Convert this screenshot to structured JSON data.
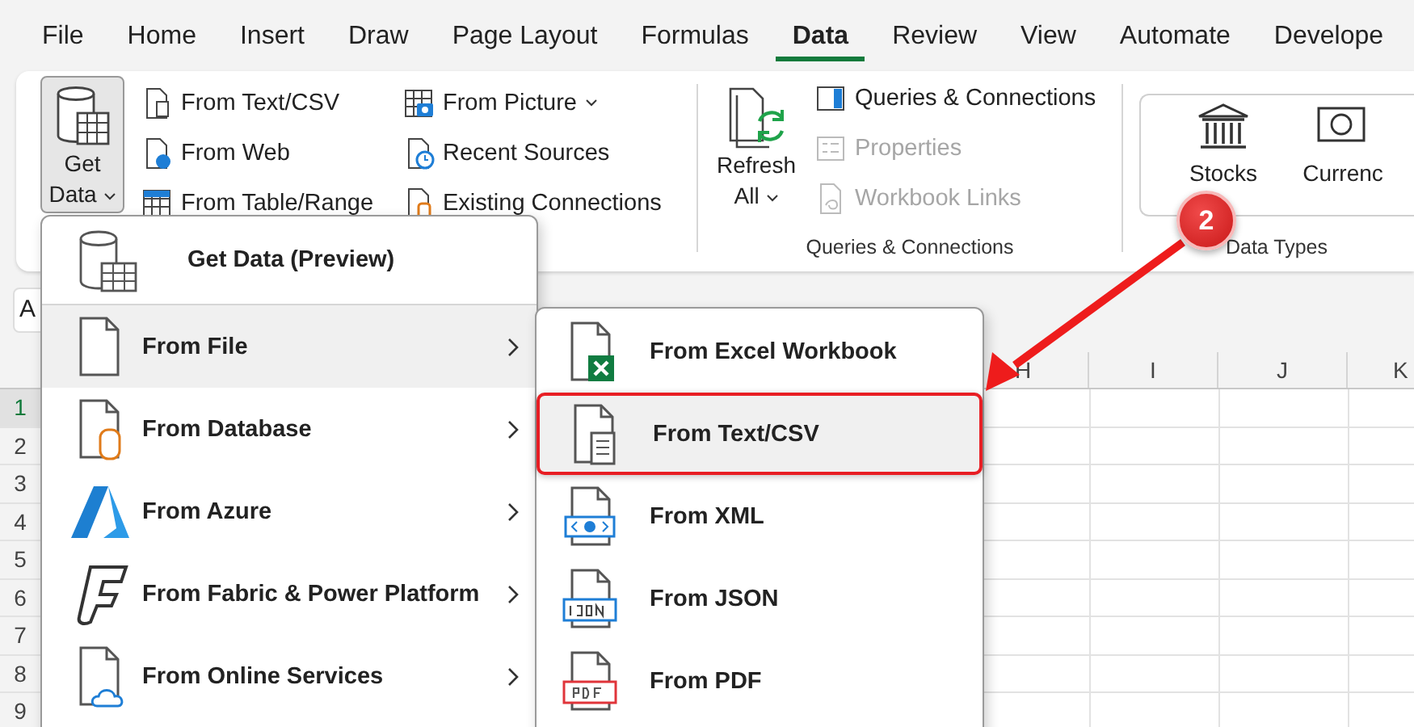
{
  "menu_tabs": [
    {
      "label": "File",
      "selected": false
    },
    {
      "label": "Home",
      "selected": false
    },
    {
      "label": "Insert",
      "selected": false
    },
    {
      "label": "Draw",
      "selected": false
    },
    {
      "label": "Page Layout",
      "selected": false
    },
    {
      "label": "Formulas",
      "selected": false
    },
    {
      "label": "Data",
      "selected": true
    },
    {
      "label": "Review",
      "selected": false
    },
    {
      "label": "View",
      "selected": false
    },
    {
      "label": "Automate",
      "selected": false
    },
    {
      "label": "Develope",
      "selected": false
    }
  ],
  "get_transform": {
    "get_data": {
      "lines": [
        "Get",
        "Data"
      ],
      "expanded": true
    },
    "columns": [
      [
        {
          "label": "From Text/CSV",
          "kind": "text",
          "dropdown": false
        },
        {
          "label": "From Web",
          "kind": "web",
          "dropdown": false
        },
        {
          "label": "From Table/Range",
          "kind": "table",
          "dropdown": false
        }
      ],
      [
        {
          "label": "From Picture",
          "kind": "picture",
          "dropdown": true
        },
        {
          "label": "Recent Sources",
          "kind": "recent",
          "dropdown": false
        },
        {
          "label": "Existing Connections",
          "kind": "existing",
          "dropdown": false
        }
      ]
    ]
  },
  "queries": {
    "refresh": {
      "lines": [
        "Refresh",
        "All"
      ]
    },
    "items": [
      {
        "label": "Queries & Connections",
        "kind": "queries",
        "disabled": false
      },
      {
        "label": "Properties",
        "kind": "properties",
        "disabled": true
      },
      {
        "label": "Workbook Links",
        "kind": "links",
        "disabled": true
      }
    ],
    "label": "Queries & Connections"
  },
  "data_types": {
    "items": [
      {
        "label": "Stocks",
        "kind": "stocks"
      },
      {
        "label": "Currenc",
        "kind": "currency"
      }
    ],
    "label": "Data Types"
  },
  "name_box": {
    "value": "A"
  },
  "sheet": {
    "columns": [
      "H",
      "I",
      "J",
      "K"
    ],
    "rows": [
      {
        "label": "1",
        "selected": true
      },
      {
        "label": "2",
        "selected": false
      },
      {
        "label": "3",
        "selected": false
      },
      {
        "label": "4",
        "selected": false
      },
      {
        "label": "5",
        "selected": false
      },
      {
        "label": "6",
        "selected": false
      },
      {
        "label": "7",
        "selected": false
      },
      {
        "label": "8",
        "selected": false
      },
      {
        "label": "9",
        "selected": false
      }
    ]
  },
  "get_data_menu": {
    "header": "Get Data (Preview)",
    "items": [
      {
        "label": "From File",
        "kind": "file",
        "selected": true
      },
      {
        "label": "From Database",
        "kind": "database",
        "selected": false
      },
      {
        "label": "From Azure",
        "kind": "azure",
        "selected": false
      },
      {
        "label": "From Fabric & Power Platform",
        "kind": "fabric",
        "selected": false
      },
      {
        "label": "From Online Services",
        "kind": "online",
        "selected": false
      }
    ]
  },
  "file_submenu": {
    "items": [
      {
        "label": "From Excel Workbook",
        "kind": "excel",
        "selected": false,
        "highlighted": false
      },
      {
        "label": "From Text/CSV",
        "kind": "text",
        "selected": true,
        "highlighted": true
      },
      {
        "label": "From XML",
        "kind": "xml",
        "selected": false,
        "highlighted": false
      },
      {
        "label": "From JSON",
        "kind": "json",
        "selected": false,
        "highlighted": false
      },
      {
        "label": "From PDF",
        "kind": "pdf",
        "selected": false,
        "highlighted": false
      }
    ]
  },
  "callout": {
    "number": "2"
  }
}
